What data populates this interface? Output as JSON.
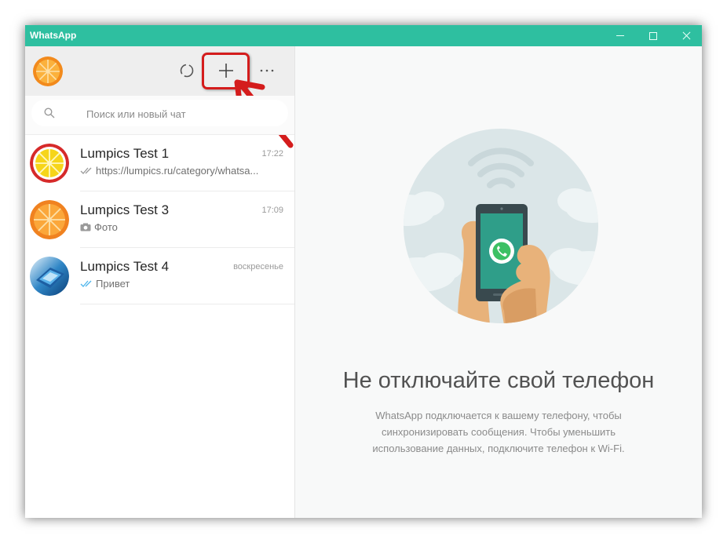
{
  "window": {
    "title": "WhatsApp",
    "accent": "#2ebfa0"
  },
  "sidebar": {
    "search": {
      "placeholder": "Поиск или новый чат",
      "value": ""
    },
    "chats": [
      {
        "name": "Lumpics Test 1",
        "time": "17:22",
        "preview": "https://lumpics.ru/category/whatsa...",
        "status_icon": "double-check-grey-icon"
      },
      {
        "name": "Lumpics Test 3",
        "time": "17:09",
        "preview": "Фото",
        "status_icon": "camera-icon"
      },
      {
        "name": "Lumpics Test 4",
        "time": "воскресенье",
        "preview": "Привет",
        "status_icon": "double-check-blue-icon"
      }
    ]
  },
  "main": {
    "title": "Не отключайте свой телефон",
    "description": "WhatsApp подключается к вашему телефону, чтобы синхронизировать сообщения. Чтобы уменьшить использование данных, подключите телефон к Wi-Fi."
  },
  "annotation": {
    "highlight_color": "#d41c1c"
  }
}
